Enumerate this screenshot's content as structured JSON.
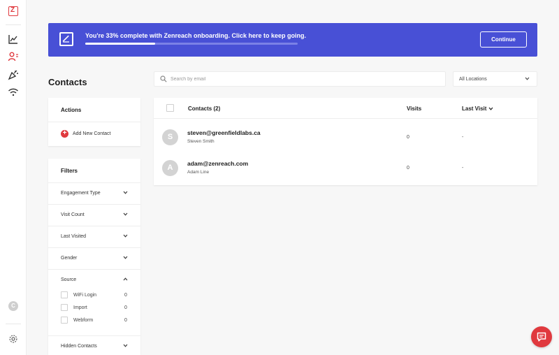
{
  "app": {
    "logo_letter": "Z",
    "user_initial": "C"
  },
  "nav": {
    "icons": [
      "analytics-icon",
      "contacts-icon",
      "campaigns-icon",
      "wifi-icon",
      "settings-icon"
    ],
    "active": "contacts-icon"
  },
  "banner": {
    "text": "You're 33% complete with Zenreach onboarding. Click here to keep going.",
    "progress_percent": 33,
    "button_label": "Continue"
  },
  "page": {
    "title": "Contacts"
  },
  "search": {
    "placeholder": "Search by email",
    "value": ""
  },
  "location_select": {
    "selected": "All Locations"
  },
  "actions": {
    "title": "Actions",
    "add_contact_label": "Add New Contact"
  },
  "filters": {
    "title": "Filters",
    "items": [
      {
        "label": "Engagement Type",
        "expanded": false
      },
      {
        "label": "Visit Count",
        "expanded": false
      },
      {
        "label": "Last Visited",
        "expanded": false
      },
      {
        "label": "Gender",
        "expanded": false
      },
      {
        "label": "Source",
        "expanded": true
      },
      {
        "label": "Hidden Contacts",
        "expanded": false
      }
    ],
    "source_options": [
      {
        "label": "WiFi Login",
        "count": "0",
        "checked": false
      },
      {
        "label": "Import",
        "count": "0",
        "checked": false
      },
      {
        "label": "Webform",
        "count": "0",
        "checked": false
      }
    ]
  },
  "table": {
    "headers": {
      "contacts": "Contacts (2)",
      "visits": "Visits",
      "last_visit": "Last Visit"
    },
    "rows": [
      {
        "initial": "S",
        "email": "steven@greenfieldlabs.ca",
        "name": "Steven Smith",
        "visits": "0",
        "last_visit": "-"
      },
      {
        "initial": "A",
        "email": "adam@zenreach.com",
        "name": "Adam Line",
        "visits": "0",
        "last_visit": "-"
      }
    ]
  },
  "colors": {
    "brand_red": "#e0393e",
    "banner_blue": "#4850d6",
    "background": "#f7f7f7"
  }
}
